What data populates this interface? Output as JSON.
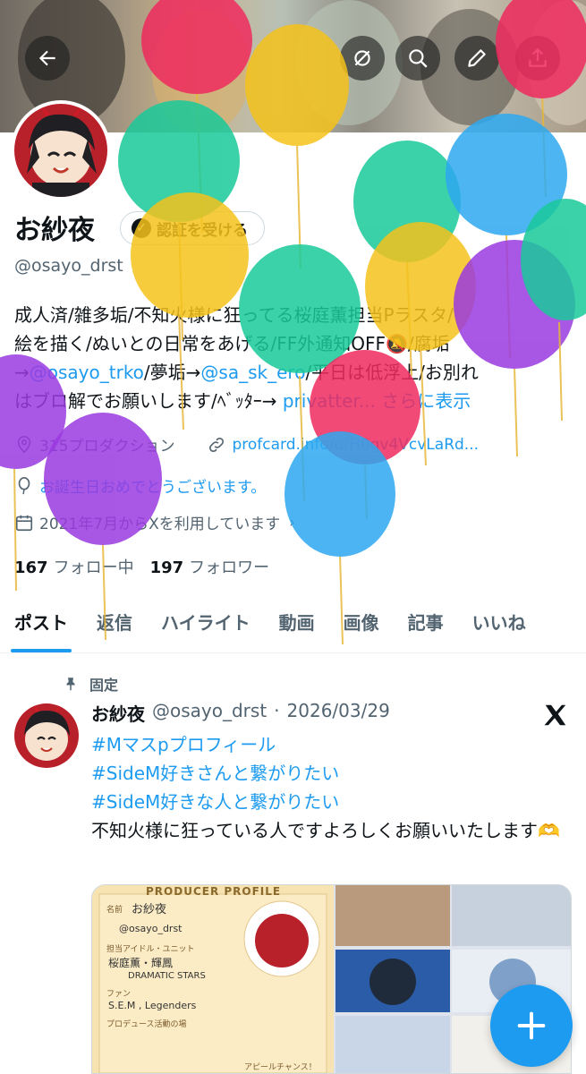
{
  "profile": {
    "name": "お紗夜",
    "follow_label": "認証を受ける",
    "handle": "@osayo_drst",
    "bio": {
      "line1": "成人済/雑多垢/不知火様に狂ってる桜庭薫担当Pラスタ/",
      "line2": "絵を描く/ぬいとの日常をあげる/FF外通知OFF🔕/腐垢",
      "line3_prefix": "→",
      "line3_link1": "@osayo_trko",
      "line3_mid": "/夢垢→",
      "line3_link2": "@sa_sk_ero",
      "line3_suffix": "/平日は低浮上/お別れ",
      "line4": "はブロ解でお願いします/ﾍﾞｯﾀｰ→ ",
      "line4_link": "privatter...",
      "more": "さらに表示"
    },
    "category": "315プロダクション",
    "website": "profcard.info/u/H0gv4VcvLaRd...",
    "birthday": "お誕生日おめでとうございます。",
    "joined": "2021年7月からXを利用しています",
    "following_count": "167",
    "following_label": "フォロー中",
    "followers_count": "197",
    "followers_label": "フォロワー"
  },
  "tabs": [
    {
      "label": "ポスト"
    },
    {
      "label": "返信"
    },
    {
      "label": "ハイライト"
    },
    {
      "label": "動画"
    },
    {
      "label": "画像"
    },
    {
      "label": "記事"
    },
    {
      "label": "いいね"
    }
  ],
  "pinned_post": {
    "pinned_label": "固定",
    "author": "お紗夜",
    "handle": "@osayo_drst",
    "dot": "·",
    "date": "2026/03/29",
    "tags": [
      "#Mマスpプロフィール",
      "#SideM好きさんと繋がりたい",
      "#SideM好きな人と繋がりたい"
    ],
    "text": "不知火様に狂っている人ですよろしくお願いいたします🫶",
    "card": {
      "title": "PRODUCER PROFILE",
      "name_label": "名前",
      "name_value": "お紗夜",
      "handle_value": "@osayo_drst",
      "idol_label": "担当アイドル・ユニット",
      "idol_value": "桜庭薫・輝鳳",
      "unit_value": "DRAMATIC STARS",
      "fan_label": "ファン",
      "fan_value": "S.E.M , Legenders",
      "activity_label": "プロデュース活動の場",
      "appeal_label": "アピールチャンス！"
    }
  },
  "colors": {
    "accent": "#1d9bf0",
    "text_primary": "#0f1419",
    "text_secondary": "#536471"
  },
  "icons": {
    "back": "arrow-left-icon",
    "mute": "circle-slash-icon",
    "search": "search-icon",
    "edit": "pencil-icon",
    "share": "share-icon",
    "pin": "pin-icon",
    "compose": "plus-icon"
  }
}
